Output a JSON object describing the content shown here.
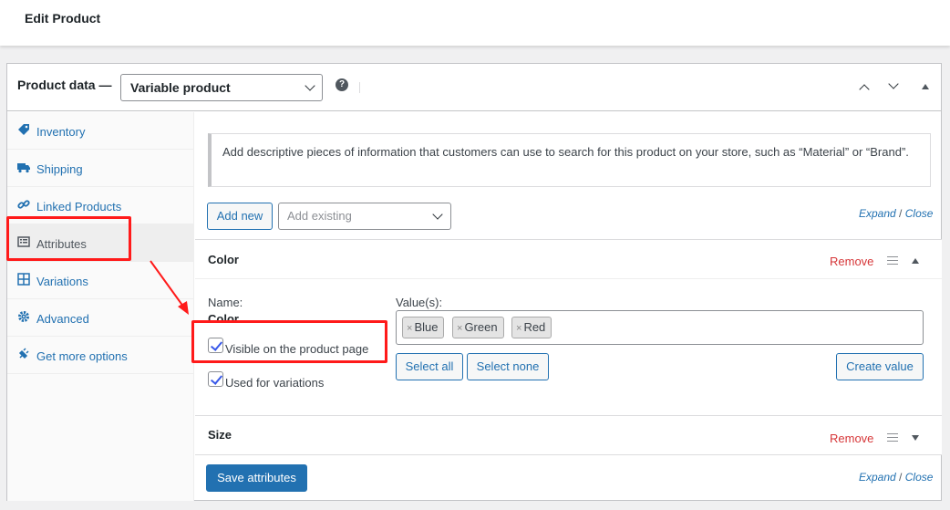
{
  "page": {
    "title": "Edit Product"
  },
  "product_data": {
    "label": "Product data —",
    "type_selected": "Variable product",
    "help_glyph": "?"
  },
  "tabs": [
    {
      "label": "Inventory",
      "icon": "tag-icon"
    },
    {
      "label": "Shipping",
      "icon": "truck-icon"
    },
    {
      "label": "Linked Products",
      "icon": "link-icon"
    },
    {
      "label": "Attributes",
      "icon": "list-icon",
      "active": true
    },
    {
      "label": "Variations",
      "icon": "grid-icon"
    },
    {
      "label": "Advanced",
      "icon": "gear-icon"
    },
    {
      "label": "Get more options",
      "icon": "plugin-icon"
    }
  ],
  "notice": "Add descriptive pieces of information that customers can use to search for this product on your store, such as “Material” or “Brand”.",
  "toolbar": {
    "add_new": "Add new",
    "add_existing_placeholder": "Add existing",
    "expand": "Expand",
    "slash": "/",
    "close": "Close"
  },
  "attributes": [
    {
      "name": "Color",
      "remove": "Remove",
      "name_label": "Name:",
      "name_value": "Color",
      "values_label": "Value(s):",
      "values": [
        "Blue",
        "Green",
        "Red"
      ],
      "chip_remove_glyph": "×",
      "visible_label": "Visible on the product page",
      "visible_checked": true,
      "variations_label": "Used for variations",
      "variations_checked": true,
      "select_all": "Select all",
      "select_none": "Select none",
      "create_value": "Create value"
    },
    {
      "name": "Size",
      "remove": "Remove"
    }
  ],
  "footer": {
    "save": "Save attributes",
    "expand": "Expand",
    "slash": "/",
    "close": "Close"
  },
  "colors": {
    "accent": "#2271b1",
    "danger": "#d63638",
    "highlight": "#ff1a1a"
  }
}
